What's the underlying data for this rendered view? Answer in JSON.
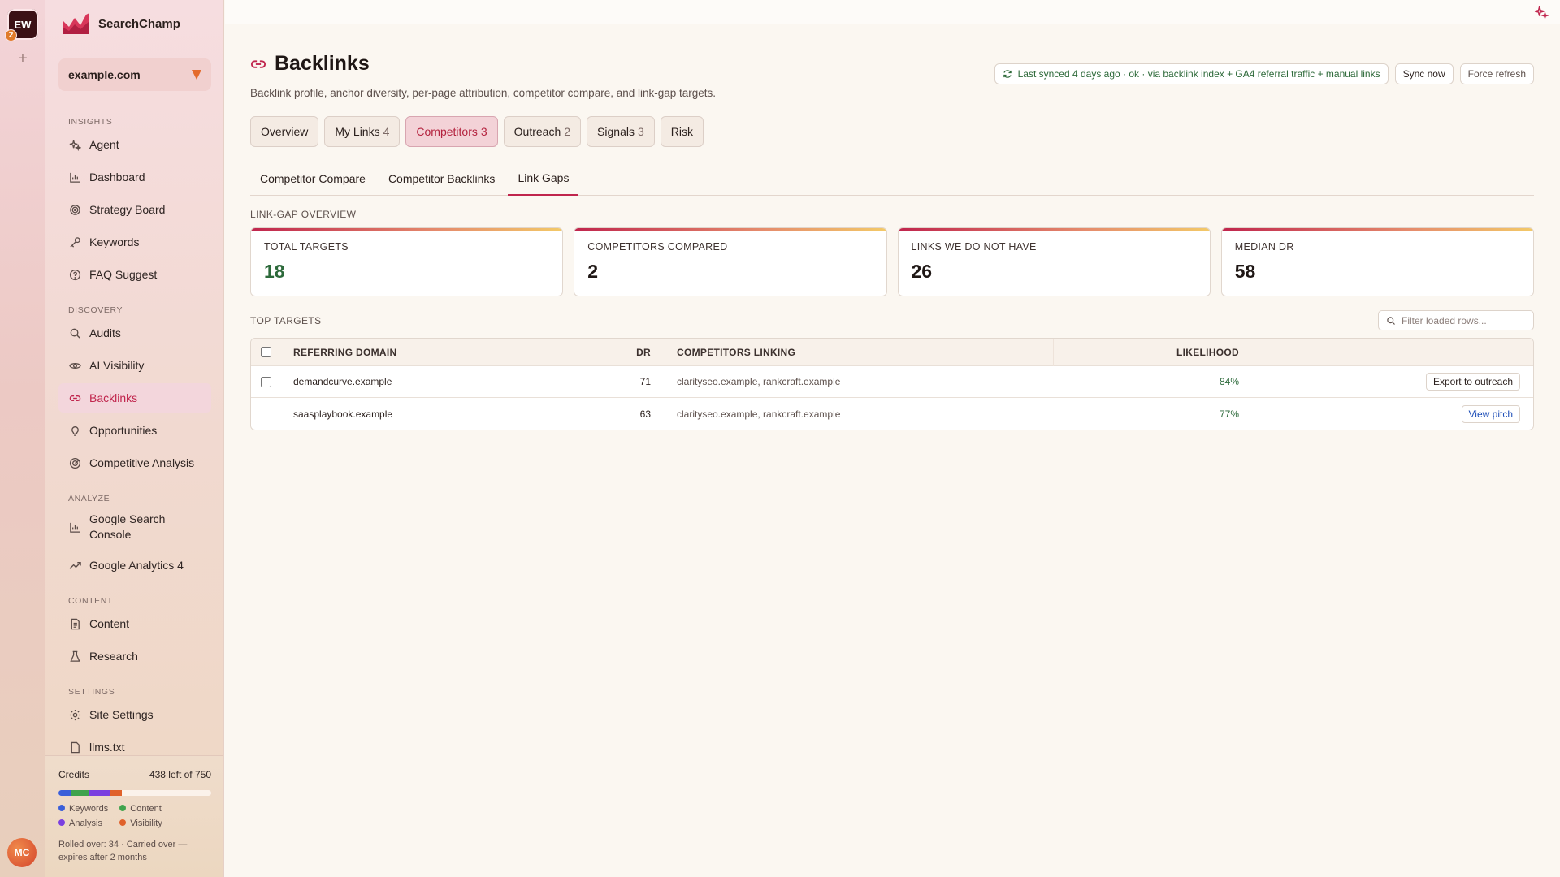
{
  "rail": {
    "workspace_initials": "EW",
    "workspace_badge": "2",
    "add_label": "+",
    "user_initials": "MC"
  },
  "brand": {
    "name": "SearchChamp"
  },
  "site": {
    "selected": "example.com"
  },
  "nav": {
    "sections": [
      {
        "label": "INSIGHTS",
        "items": [
          {
            "label": "Agent",
            "icon": "sparkle-icon"
          },
          {
            "label": "Dashboard",
            "icon": "bar-chart-icon"
          },
          {
            "label": "Strategy Board",
            "icon": "target-icon"
          },
          {
            "label": "Keywords",
            "icon": "key-icon"
          },
          {
            "label": "FAQ Suggest",
            "icon": "help-circle-icon"
          }
        ]
      },
      {
        "label": "DISCOVERY",
        "items": [
          {
            "label": "Audits",
            "icon": "search-icon"
          },
          {
            "label": "AI Visibility",
            "icon": "eye-icon"
          },
          {
            "label": "Backlinks",
            "icon": "link-icon",
            "active": true
          },
          {
            "label": "Opportunities",
            "icon": "lightbulb-icon"
          },
          {
            "label": "Competitive Analysis",
            "icon": "radar-icon"
          }
        ]
      },
      {
        "label": "ANALYZE",
        "items": [
          {
            "label": "Google Search Console",
            "icon": "bar-chart-icon"
          },
          {
            "label": "Google Analytics 4",
            "icon": "trending-up-icon"
          }
        ]
      },
      {
        "label": "CONTENT",
        "items": [
          {
            "label": "Content",
            "icon": "document-icon"
          },
          {
            "label": "Research",
            "icon": "flask-icon"
          }
        ]
      },
      {
        "label": "SETTINGS",
        "items": [
          {
            "label": "Site Settings",
            "icon": "gear-icon"
          },
          {
            "label": "llms.txt",
            "icon": "file-icon"
          }
        ]
      }
    ]
  },
  "credits": {
    "label": "Credits",
    "summary": "438 left of 750",
    "used": 312,
    "total": 750,
    "segments": [
      {
        "name": "Keywords",
        "color": "#3b5fd9",
        "value": 60
      },
      {
        "name": "Content",
        "color": "#3fa34d",
        "value": 90
      },
      {
        "name": "Analysis",
        "color": "#7b3fe0",
        "value": 100
      },
      {
        "name": "Visibility",
        "color": "#e0612a",
        "value": 62
      }
    ],
    "note": "Rolled over: 34 · Carried over — expires after 2 months"
  },
  "page": {
    "title": "Backlinks",
    "subtitle": "Backlink profile, anchor diversity, per-page attribution, competitor compare, and link-gap targets."
  },
  "sync": {
    "status": "Last synced 4 days ago · ok · via backlink index + GA4 referral traffic + manual links",
    "sync_now": "Sync now",
    "force_refresh": "Force refresh"
  },
  "tabs": [
    {
      "label": "Overview",
      "count": ""
    },
    {
      "label": "My Links",
      "count": "4"
    },
    {
      "label": "Competitors",
      "count": "3",
      "active": true
    },
    {
      "label": "Outreach",
      "count": "2"
    },
    {
      "label": "Signals",
      "count": "3"
    },
    {
      "label": "Risk",
      "count": ""
    }
  ],
  "subtabs": [
    {
      "label": "Competitor Compare"
    },
    {
      "label": "Competitor Backlinks"
    },
    {
      "label": "Link Gaps",
      "active": true
    }
  ],
  "overview": {
    "label": "LINK-GAP OVERVIEW",
    "cards": [
      {
        "key": "TOTAL TARGETS",
        "value": "18"
      },
      {
        "key": "COMPETITORS COMPARED",
        "value": "2"
      },
      {
        "key": "LINKS WE DO NOT HAVE",
        "value": "26"
      },
      {
        "key": "MEDIAN DR",
        "value": "58"
      }
    ]
  },
  "targets": {
    "label": "TOP TARGETS",
    "filter_placeholder": "Filter loaded rows...",
    "columns": {
      "domain": "REFERRING DOMAIN",
      "dr": "DR",
      "competitors": "COMPETITORS LINKING",
      "likelihood": "LIKELIHOOD"
    },
    "rows": [
      {
        "domain": "demandcurve.example",
        "dr": "71",
        "competitors": "clarityseo.example, rankcraft.example",
        "likelihood": "84%",
        "action": "Export to outreach"
      },
      {
        "domain": "saasplaybook.example",
        "dr": "63",
        "competitors": "clarityseo.example, rankcraft.example",
        "likelihood": "77%",
        "action": "View pitch"
      }
    ]
  }
}
